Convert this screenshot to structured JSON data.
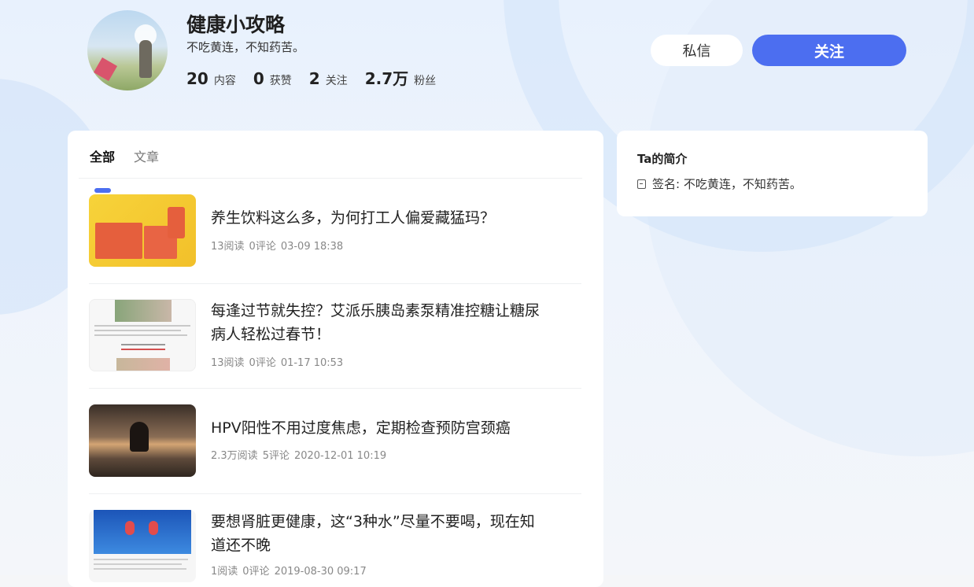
{
  "profile": {
    "name": "健康小攻略",
    "motto": "不吃黄连，不知药苦。",
    "stats": [
      {
        "num": "20",
        "label": "内容"
      },
      {
        "num": "0",
        "label": "获赞"
      },
      {
        "num": "2",
        "label": "关注"
      },
      {
        "num": "2.7万",
        "label": "粉丝"
      }
    ]
  },
  "actions": {
    "message_label": "私信",
    "follow_label": "关注"
  },
  "tabs": [
    {
      "label": "全部",
      "active": true
    },
    {
      "label": "文章",
      "active": false
    }
  ],
  "articles": [
    {
      "title": "养生饮料这么多，为何打工人偏爱藏猛玛？",
      "reads": "13阅读",
      "comments": "0评论",
      "time": "03-09 18:38"
    },
    {
      "title": "每逢过节就失控？艾派乐胰岛素泵精准控糖让糖尿病人轻松过春节！",
      "reads": "13阅读",
      "comments": "0评论",
      "time": "01-17 10:53"
    },
    {
      "title": "HPV阳性不用过度焦虑，定期检查预防宫颈癌",
      "reads": "2.3万阅读",
      "comments": "5评论",
      "time": "2020-12-01 10:19"
    },
    {
      "title": "要想肾脏更健康，这“3种水”尽量不要喝，现在知道还不晚",
      "reads": "1阅读",
      "comments": "0评论",
      "time": "2019-08-30 09:17"
    }
  ],
  "intro": {
    "title": "Ta的简介",
    "signature": "签名: 不吃黄连，不知药苦。"
  },
  "colors": {
    "accent": "#4c6ef0"
  }
}
